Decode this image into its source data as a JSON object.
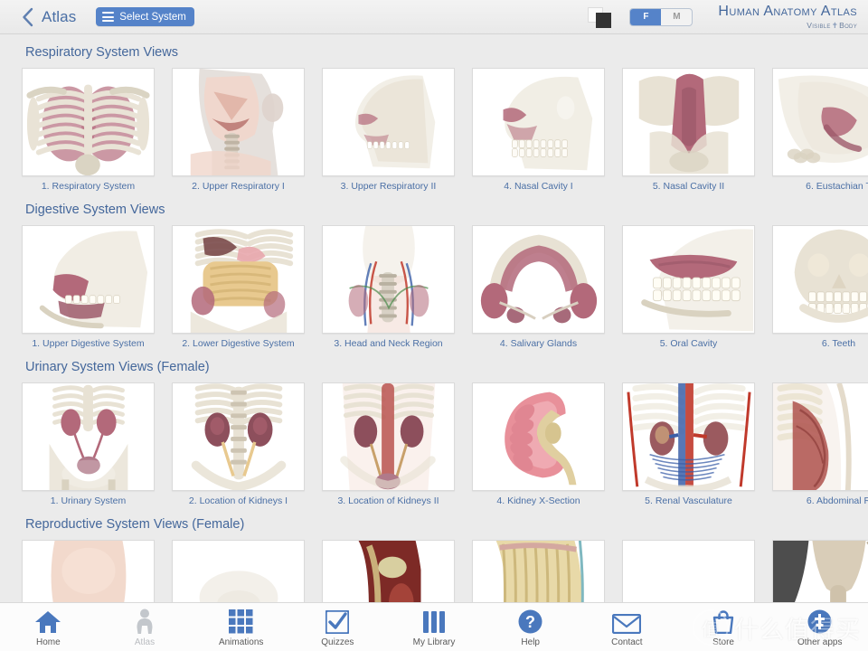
{
  "header": {
    "back_icon": "chevron-left-icon",
    "title": "Atlas",
    "select_system_label": "Select System",
    "menu_icon": "hamburger-icon",
    "background_toggle_icon": "background-swatch-icon",
    "gender_toggle": {
      "options": [
        "F",
        "M"
      ],
      "selected": "F"
    },
    "brand_main": "Human Anatomy Atlas",
    "brand_sub_left": "Visible",
    "brand_sub_right": "Body",
    "colors": {
      "accent_blue": "#5583c9",
      "title_blue": "#4a6fa5",
      "brand_blue": "#44679b",
      "page_background": "#ebebeb",
      "header_background": "#eeeeee"
    }
  },
  "sections": [
    {
      "title": "Respiratory System Views",
      "tiles": [
        {
          "caption": "1. Respiratory System",
          "thumb": "thoracic-ribs-lungs"
        },
        {
          "caption": "2. Upper Respiratory I",
          "thumb": "head-neck-airway"
        },
        {
          "caption": "3. Upper Respiratory II",
          "thumb": "skull-sagittal-airway"
        },
        {
          "caption": "4. Nasal Cavity I",
          "thumb": "skull-nasal-lateral"
        },
        {
          "caption": "5. Nasal Cavity II",
          "thumb": "nasal-cavity-coronal"
        },
        {
          "caption": "6. Eustachian T",
          "thumb": "eustachian-tube"
        }
      ]
    },
    {
      "title": "Digestive System Views",
      "tiles": [
        {
          "caption": "1. Upper Digestive System",
          "thumb": "skull-mouth-lateral"
        },
        {
          "caption": "2. Lower Digestive System",
          "thumb": "abdomen-intestines"
        },
        {
          "caption": "3. Head and Neck Region",
          "thumb": "head-neck-vessels"
        },
        {
          "caption": "4. Salivary Glands",
          "thumb": "salivary-glands-arch"
        },
        {
          "caption": "5. Oral Cavity",
          "thumb": "oral-cavity-tongue"
        },
        {
          "caption": "6. Teeth",
          "thumb": "skull-teeth-front"
        }
      ]
    },
    {
      "title": "Urinary System Views (Female)",
      "tiles": [
        {
          "caption": "1. Urinary System",
          "thumb": "pelvis-urinary-full"
        },
        {
          "caption": "2. Location of Kidneys I",
          "thumb": "kidneys-posterior"
        },
        {
          "caption": "3. Location of Kidneys II",
          "thumb": "kidneys-anterior-torso"
        },
        {
          "caption": "4. Kidney X-Section",
          "thumb": "kidney-cross-section"
        },
        {
          "caption": "5. Renal Vasculature",
          "thumb": "renal-vasculature"
        },
        {
          "caption": "6. Abdominal R",
          "thumb": "abdominal-muscles-lateral"
        }
      ]
    },
    {
      "title": "Reproductive System Views (Female)",
      "tiles": [
        {
          "caption": "",
          "thumb": "torso-skin-front"
        },
        {
          "caption": "",
          "thumb": "pelvis-faint"
        },
        {
          "caption": "",
          "thumb": "internal-organs-closeup"
        },
        {
          "caption": "",
          "thumb": "pelvis-muscles-yellow"
        },
        {
          "caption": "",
          "thumb": "blank-white"
        },
        {
          "caption": "",
          "thumb": "uterus-specimen"
        }
      ]
    }
  ],
  "tabbar": {
    "tabs": [
      {
        "label": "Home",
        "icon": "house-icon",
        "active": false
      },
      {
        "label": "Atlas",
        "icon": "person-icon",
        "active": true
      },
      {
        "label": "Animations",
        "icon": "grid-icon",
        "active": false
      },
      {
        "label": "Quizzes",
        "icon": "checkmark-icon",
        "active": false
      },
      {
        "label": "My Library",
        "icon": "books-icon",
        "active": false
      },
      {
        "label": "Help",
        "icon": "question-circle-icon",
        "active": false
      },
      {
        "label": "Contact",
        "icon": "envelope-icon",
        "active": false
      },
      {
        "label": "Store",
        "icon": "store-bag-icon",
        "active": false
      },
      {
        "label": "Other apps",
        "icon": "apps-circle-icon",
        "active": false
      }
    ]
  },
  "watermark": {
    "badge": "值",
    "text": "什么值得买"
  }
}
